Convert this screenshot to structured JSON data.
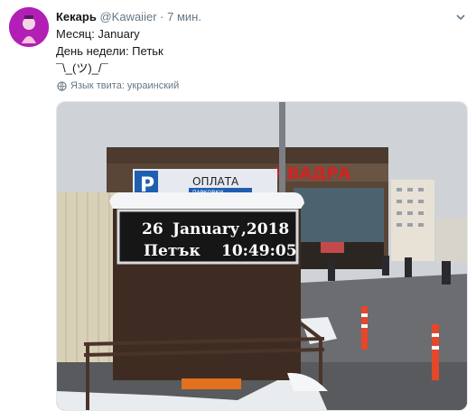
{
  "tweet": {
    "author_name": "Кекарь",
    "author_handle": "@Kawaiier",
    "separator": "·",
    "time": "7 мин.",
    "lines": [
      "Месяц: January",
      "День недели: Петьк",
      "¯\\_(ツ)_/¯"
    ],
    "language_note": "Язык твита: украинский"
  },
  "photo": {
    "led_line1_day": "26",
    "led_line1_month": "January",
    "led_line1_year": ",2018",
    "led_line2_weekday": "Петък",
    "led_line2_time": "10:49:05",
    "sign_parking_letter": "P",
    "sign_parking_text": "ОПЛАТА",
    "sign_parking_subtext": "ПАРКОВКИ",
    "store_sign": "КВАДРА"
  },
  "colors": {
    "avatar_bg": "#b21fb5",
    "muted": "#657786",
    "store_red": "#d22222",
    "led_bg": "#161616"
  },
  "icons": [
    "caret-down-icon",
    "globe-icon"
  ]
}
